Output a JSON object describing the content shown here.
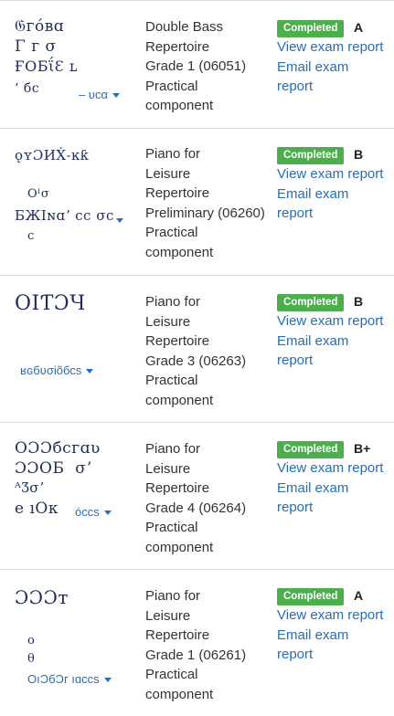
{
  "colors": {
    "badge_green": "#4cae4c",
    "link_blue": "#2a6db0",
    "text_dark": "#333333",
    "divider": "#d9d9d9"
  },
  "results": [
    {
      "subject_lines": [
        "Double Bass",
        "Repertoire",
        "Grade 1 (06051)",
        "Practical",
        "component"
      ],
      "status": "Completed",
      "grade": "A",
      "view_report": "View exam report",
      "email_report": "Email exam report"
    },
    {
      "subject_lines": [
        "Piano for",
        "Leisure",
        "Repertoire",
        "Preliminary (06260)",
        "Practical",
        "component"
      ],
      "status": "Completed",
      "grade": "B",
      "view_report": "View exam report",
      "email_report": "Email exam report"
    },
    {
      "subject_lines": [
        "Piano for",
        "Leisure",
        "Repertoire",
        "Grade 3 (06263)",
        "Practical",
        "component"
      ],
      "status": "Completed",
      "grade": "B",
      "view_report": "View exam report",
      "email_report": "Email exam report"
    },
    {
      "subject_lines": [
        "Piano for",
        "Leisure",
        "Repertoire",
        "Grade 4 (06264)",
        "Practical",
        "component"
      ],
      "status": "Completed",
      "grade": "B+",
      "view_report": "View exam report",
      "email_report": "Email exam report"
    },
    {
      "subject_lines": [
        "Piano for",
        "Leisure",
        "Repertoire",
        "Grade 1 (06261)",
        "Practical",
        "component"
      ],
      "status": "Completed",
      "grade": "A",
      "view_report": "View exam report",
      "email_report": "Email exam report"
    }
  ]
}
